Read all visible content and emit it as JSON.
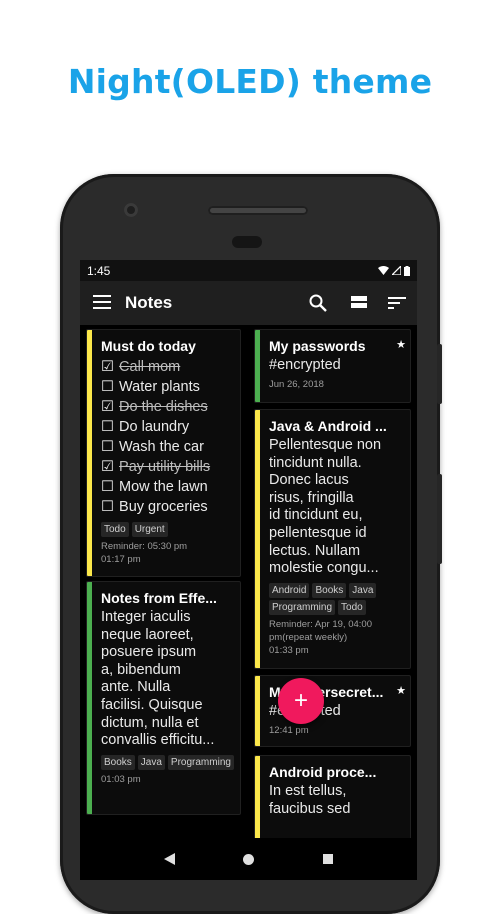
{
  "headline": "Night(OLED) theme",
  "status": {
    "time": "1:45"
  },
  "appbar": {
    "title": "Notes"
  },
  "colors": {
    "accent_yellow": "#fbe74a",
    "accent_green": "#4caf50",
    "fab": "#f0195d",
    "headline": "#1aa3e8"
  },
  "icons": [
    "menu-icon",
    "search-icon",
    "view-toggle-icon",
    "sort-icon",
    "star-icon",
    "add-icon",
    "back-icon",
    "home-icon",
    "recents-icon"
  ],
  "notes": {
    "must_do": {
      "title": "Must do today",
      "items": [
        {
          "text": "Call mom",
          "done": true
        },
        {
          "text": "Water plants",
          "done": false
        },
        {
          "text": "Do the dishes",
          "done": true
        },
        {
          "text": "Do laundry",
          "done": false
        },
        {
          "text": "Wash the car",
          "done": false
        },
        {
          "text": "Pay utility bills",
          "done": true
        },
        {
          "text": "Mow the lawn",
          "done": false
        },
        {
          "text": "Buy groceries",
          "done": false
        }
      ],
      "tags": [
        "Todo",
        "Urgent"
      ],
      "reminder": "Reminder: 05:30 pm",
      "time": "01:17 pm"
    },
    "effe": {
      "title": "Notes from Effe...",
      "body": [
        "Integer iaculis",
        "neque laoreet,",
        "posuere ipsum",
        "a, bibendum",
        "ante. Nulla",
        "facilisi. Quisque",
        "dictum, nulla et",
        "convallis efficitu..."
      ],
      "tags": [
        "Books",
        "Java",
        "Programming"
      ],
      "time": "01:03 pm"
    },
    "passwords": {
      "title": "My passwords",
      "body": "#encrypted",
      "date": "Jun 26, 2018"
    },
    "java": {
      "title": "Java & Android ...",
      "body": [
        "Pellentesque non",
        "tincidunt nulla.",
        "Donec lacus",
        "risus, fringilla",
        "id tincidunt eu,",
        "pellentesque id",
        "lectus. Nullam",
        "molestie congu..."
      ],
      "tags": [
        "Android",
        "Books",
        "Java",
        "Programming",
        "Todo"
      ],
      "reminder": "Reminder: Apr 19, 04:00",
      "reminder2": "pm(repeat weekly)",
      "time": "01:33 pm"
    },
    "supersecret": {
      "title": "My supersecret...",
      "body": "#encrypted",
      "time": "12:41 pm"
    },
    "android": {
      "title": "Android proce...",
      "body": [
        "In est tellus,",
        "faucibus sed"
      ]
    }
  },
  "fab": {
    "label": "+"
  }
}
